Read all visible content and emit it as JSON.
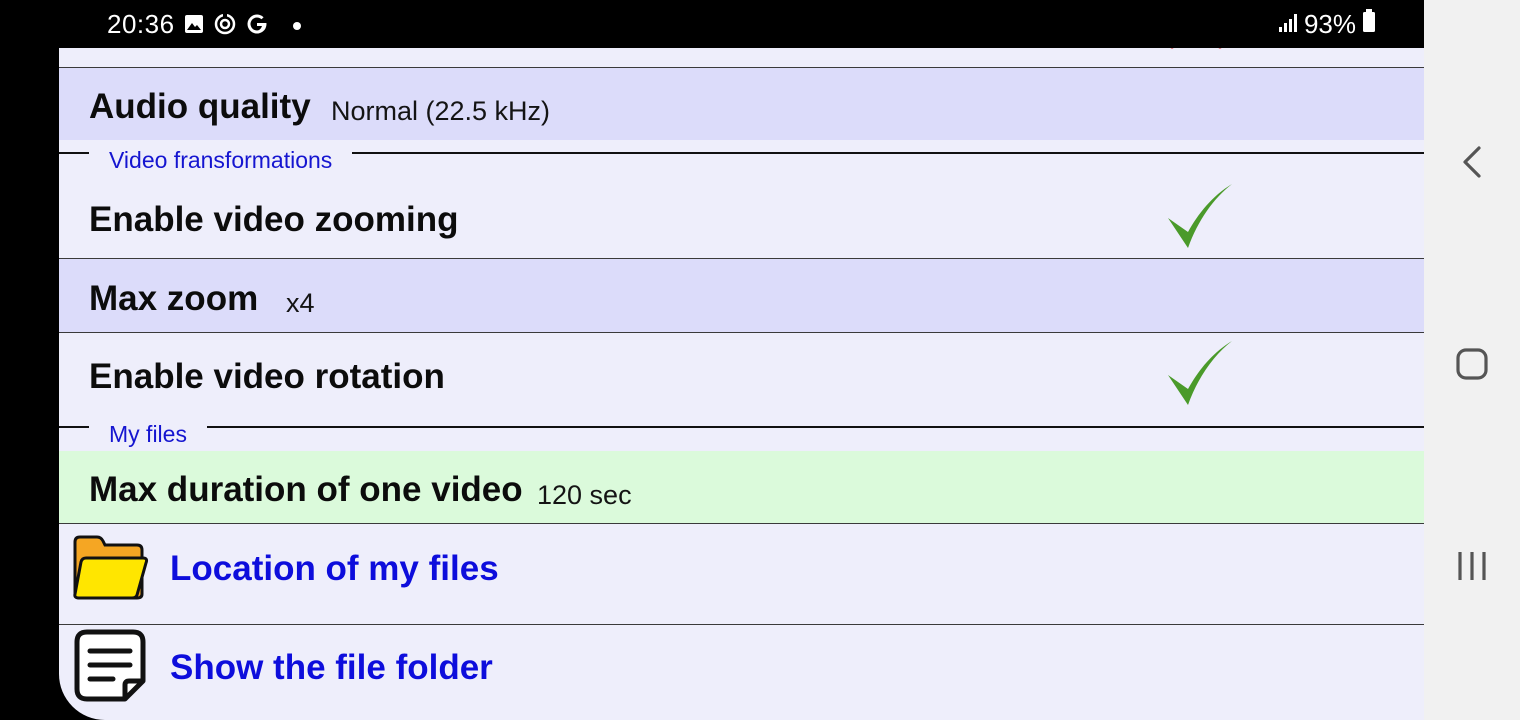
{
  "status_bar": {
    "time": "20:36",
    "left_icons": [
      "gallery-icon",
      "sync-icon",
      "google-icon",
      "dot-icon"
    ],
    "battery_percent": "93%"
  },
  "settings": {
    "audio_quality": {
      "title": "Audio quality",
      "value": "Normal (22.5 kHz)"
    },
    "section_video": "Video fransformations",
    "enable_zoom": {
      "title": "Enable video zooming",
      "checked": true
    },
    "max_zoom": {
      "title": "Max zoom",
      "value": "x4"
    },
    "enable_rotation": {
      "title": "Enable video rotation",
      "checked": true
    },
    "section_files": "My files",
    "max_duration": {
      "title": "Max duration of one video",
      "value": "120 sec"
    },
    "location_link": "Location of my files",
    "show_folder_link": "Show the file folder"
  },
  "colors": {
    "row_blue": "#dcdcfa",
    "row_green": "#dbfadb",
    "panel_bg": "#eeeefb",
    "link_color": "#0d0ddc",
    "section_color": "#1515d0",
    "check_green": "#4a9a2a"
  }
}
